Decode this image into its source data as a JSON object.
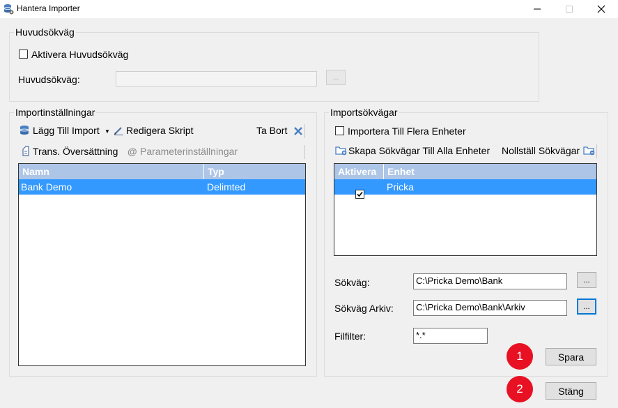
{
  "window": {
    "title": "Hantera Importer",
    "app_icon": "database-gear-icon",
    "minimize_icon": "minimize-icon",
    "maximize_icon": "maximize-icon",
    "close_icon": "close-icon"
  },
  "main_path_group": {
    "legend": "Huvudsökväg",
    "activate_label": "Aktivera Huvudsökväg",
    "activate_checked": false,
    "path_label": "Huvudsökväg:",
    "path_value": "",
    "browse_label": "..."
  },
  "import_settings": {
    "legend": "Importinställningar",
    "add_import": "Lägg Till Import",
    "edit_script": "Redigera Skript",
    "delete": "Ta Bort",
    "translation": "Trans. Översättning",
    "parameters": "Parameterinställningar",
    "columns": [
      "Namn",
      "Typ"
    ],
    "rows": [
      {
        "name": "Bank Demo",
        "type": "Delimted",
        "selected": true
      }
    ]
  },
  "import_paths": {
    "legend": "Importsökvägar",
    "multi_units_label": "Importera Till Flera Enheter",
    "multi_units_checked": false,
    "create_paths": "Skapa Sökvägar Till Alla Enheter",
    "reset_paths": "Nollställ Sökvägar",
    "columns": [
      "Aktivera",
      "Enhet"
    ],
    "rows": [
      {
        "active": true,
        "unit": "Pricka",
        "selected": true
      }
    ],
    "path_label": "Sökväg:",
    "path_value": "C:\\Pricka Demo\\Bank",
    "archive_label": "Sökväg Arkiv:",
    "archive_value": "C:\\Pricka Demo\\Bank\\Arkiv",
    "filter_label": "Filfilter:",
    "filter_value": "*.*",
    "browse_label": "...",
    "save_label": "Spara"
  },
  "close_label": "Stäng",
  "badges": {
    "save": "1",
    "close": "2"
  },
  "colors": {
    "selection": "#3399ff",
    "header": "#adc5e6",
    "badge": "#e81123",
    "focus": "#0078d7"
  }
}
